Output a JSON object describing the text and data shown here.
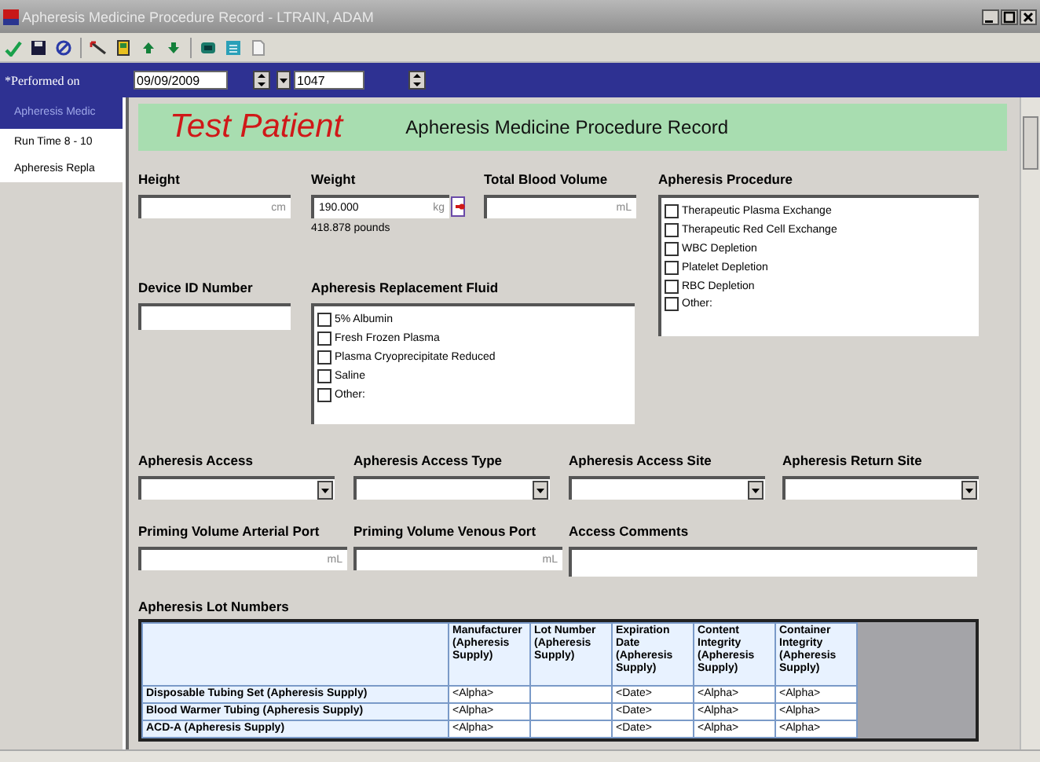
{
  "window": {
    "title": "Apheresis Medicine Procedure Record - LTRAIN, ADAM"
  },
  "performed_on": {
    "label": "*Performed on",
    "date": "09/09/2009",
    "time": "1047"
  },
  "sidebar": {
    "items": [
      {
        "label": "Apheresis Medic",
        "selected": true
      },
      {
        "label": "Run Time 8 - 10",
        "selected": false
      },
      {
        "label": "Apheresis Repla",
        "selected": false
      }
    ]
  },
  "form": {
    "patient_name": "Test Patient",
    "title": "Apheresis Medicine Procedure Record",
    "height": {
      "label": "Height",
      "unit": "cm"
    },
    "weight": {
      "label": "Weight",
      "value": "190.000",
      "unit": "kg",
      "note": "418.878 pounds"
    },
    "total_blood_volume": {
      "label": "Total Blood Volume",
      "unit": "mL"
    },
    "procedure": {
      "label": "Apheresis Procedure",
      "options": [
        {
          "label": "Therapeutic Plasma Exchange",
          "checked": false
        },
        {
          "label": "Therapeutic Red Cell Exchange",
          "checked": false
        },
        {
          "label": "WBC Depletion",
          "checked": false
        },
        {
          "label": "Platelet Depletion",
          "checked": false
        },
        {
          "label": "RBC Depletion",
          "checked": false
        },
        {
          "label": "Other:",
          "checked": false
        }
      ]
    },
    "device_id": {
      "label": "Device ID Number"
    },
    "replacement_fluid": {
      "label": "Apheresis Replacement Fluid",
      "options": [
        {
          "label": "5% Albumin",
          "checked": false
        },
        {
          "label": "Fresh Frozen Plasma",
          "checked": false
        },
        {
          "label": "Plasma Cryoprecipitate Reduced",
          "checked": false
        },
        {
          "label": "Saline",
          "checked": false
        },
        {
          "label": "Other:",
          "checked": false
        }
      ]
    },
    "access_selects": [
      {
        "label": "Apheresis Access"
      },
      {
        "label": "Apheresis Access Type"
      },
      {
        "label": "Apheresis Access Site"
      },
      {
        "label": "Apheresis Return Site"
      }
    ],
    "priming": [
      {
        "label": "Priming Volume Arterial Port",
        "unit": "mL"
      },
      {
        "label": "Priming Volume Venous Port",
        "unit": "mL"
      }
    ],
    "access_comments": {
      "label": "Access Comments"
    },
    "lot_numbers": {
      "title": "Apheresis Lot Numbers",
      "columns": [
        "Manufacturer (Apheresis Supply)",
        "Lot Number (Apheresis Supply)",
        "Expiration Date (Apheresis Supply)",
        "Content Integrity (Apheresis Supply)",
        "Container Integrity (Apheresis Supply)"
      ],
      "rows": [
        {
          "name": "Disposable Tubing Set (Apheresis Supply)",
          "cells": [
            "<Alpha>",
            null,
            "<Date>",
            "<Alpha>",
            "<Alpha>"
          ]
        },
        {
          "name": "Blood Warmer Tubing (Apheresis Supply)",
          "cells": [
            "<Alpha>",
            null,
            "<Date>",
            "<Alpha>",
            "<Alpha>"
          ]
        },
        {
          "name": "ACD-A (Apheresis Supply)",
          "cells": [
            "<Alpha>",
            null,
            "<Date>",
            "<Alpha>",
            "<Alpha>"
          ]
        }
      ]
    }
  }
}
